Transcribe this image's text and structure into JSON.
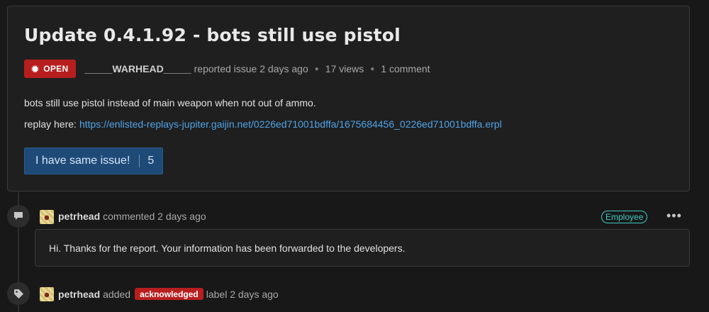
{
  "issue": {
    "title": "Update 0.4.1.92 - bots still use pistol",
    "status": "OPEN",
    "author": "_____WARHEAD_____",
    "reported": "reported issue 2 days ago",
    "views": "17 views",
    "comments": "1 comment",
    "body_line1": "bots still use pistol instead of main weapon when not out of ammo.",
    "replay_label": "replay here:",
    "replay_url": "https://enlisted-replays-jupiter.gaijin.net/0226ed71001bdffa/1675684456_0226ed71001bdffa.erpl",
    "same_issue_label": "I have same issue!",
    "same_issue_count": "5"
  },
  "comment": {
    "user": "petrhead",
    "action": "commented 2 days ago",
    "role_badge": "Employee",
    "more": "•••",
    "text": "Hi. Thanks for the report. Your information has been forwarded to the developers."
  },
  "label_event": {
    "user": "petrhead",
    "action": "added",
    "label": "acknowledged",
    "suffix": "label 2 days ago"
  },
  "colors": {
    "status_open": "#b81e1e",
    "link": "#4fa3e8",
    "employee": "#3fc9c0",
    "button_bg": "#1e4a78"
  },
  "icons": {
    "status": "gear-icon",
    "comment": "speech-bubble-icon",
    "label": "tag-icon"
  }
}
